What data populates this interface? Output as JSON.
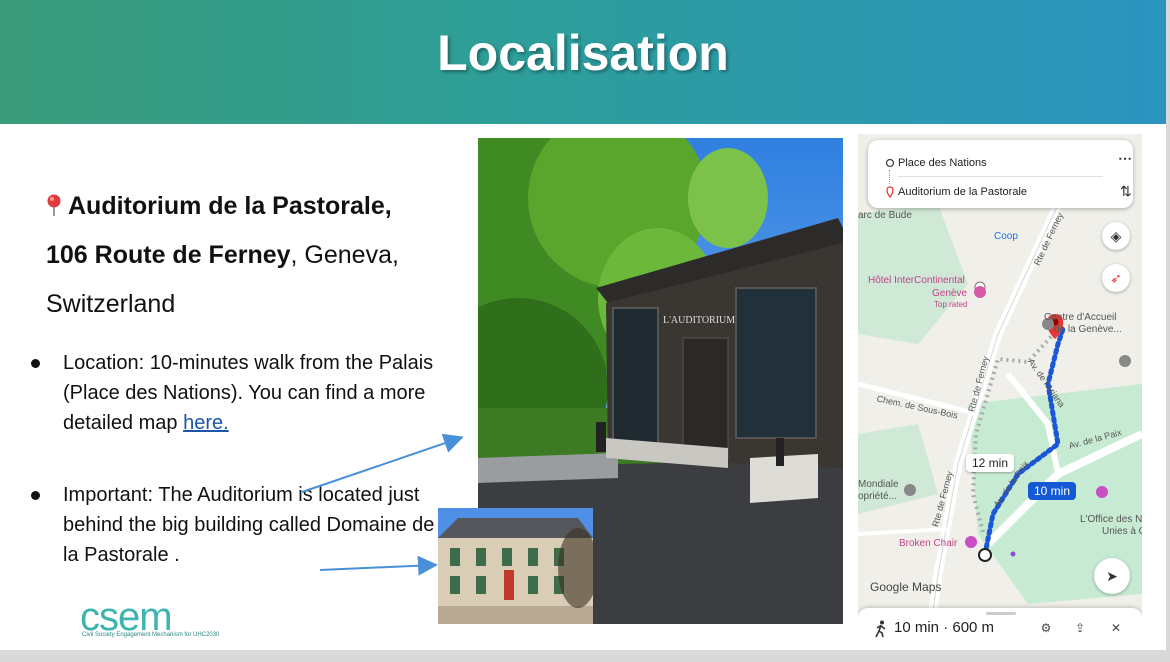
{
  "slide": {
    "title": "Localisation",
    "address": {
      "line1_bold": "Auditorium de la Pastorale,",
      "line2_bold": "106 Route de Ferney",
      "line2_rest": ", Geneva,",
      "line3": "Switzerland"
    },
    "bullets": [
      {
        "text": "Location: 10-minutes walk from the Palais (Place des Nations). You can find a more detailed map ",
        "link": "here."
      },
      {
        "text": "Important: The Auditorium is located just behind the big building called Domaine de la Pastorale ."
      }
    ],
    "building_sign": "L'AUDITORIUM",
    "logo": {
      "name": "csem",
      "tagline": "Civil Society Engagement Mechanism for UHC2030"
    }
  },
  "map": {
    "origin": "Place des Nations",
    "destination": "Auditorium de la Pastorale",
    "labels": {
      "parc": "arc de Bude",
      "coop": "Coop",
      "hotel_line1": "Hôtel InterContinental",
      "hotel_line2": "Genève",
      "hotel_line3": "Top rated",
      "centre_line1": "Centre d'Accueil",
      "centre_line2": "de la Genève...",
      "rte_ferney_top": "Rte de Ferney",
      "rte_ferney_mid": "Rte de Ferney",
      "rte_ferney_low": "Rte de Ferney",
      "av_ariana": "Av. de l'Ariana",
      "chem_sous_bois": "Chem. de Sous-Bois",
      "av_paix": "Av. de la Paix",
      "av_paix2": "Av. de la Paix",
      "mondiale_line1": "Mondiale",
      "mondiale_line2": "opriété...",
      "office_line1": "L'Office des N",
      "office_line2": "Unies à G",
      "broken_chair": "Broken Chair",
      "google_maps": "Google Maps"
    },
    "chip_alt": "12 min",
    "chip_selected": "10 min",
    "summary": "10 min · 600 m",
    "colors": {
      "route": "#1a56d6",
      "alt_route": "#a9a9a9",
      "park": "#c7ead3",
      "pin": "#e53935"
    }
  }
}
